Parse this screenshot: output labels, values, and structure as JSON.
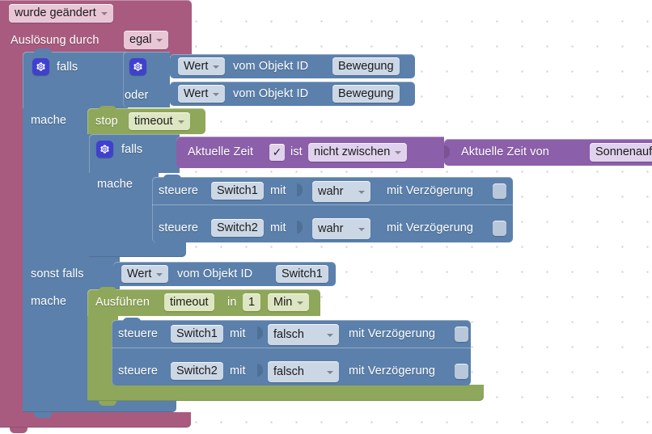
{
  "editor": {
    "name": "blockly-workspace",
    "background": "#ffffff",
    "grid_dot_color": "#cdcdd4",
    "colors": {
      "trigger_pink": "#a85b7f",
      "logic_blue": "#5b80ab",
      "timer_olive": "#8fa75a",
      "time_purple": "#8c5faa",
      "mutator_gear": "#4040d0"
    }
  },
  "trigger_block": {
    "name": "on-change-trigger",
    "event_dropdown": "wurde geändert",
    "source_label": "Auslösung durch",
    "source_dropdown": "egal"
  },
  "outer_if": {
    "if_label": "falls",
    "else_if_label": "sonst falls",
    "do_label": "mache",
    "condition_or_label": "oder",
    "condition_a": {
      "value_dropdown": "Wert",
      "middle_label": "vom Objekt ID",
      "object_id": "Bewegung"
    },
    "condition_b": {
      "value_dropdown": "Wert",
      "middle_label": "vom Objekt ID",
      "object_id": "Bewegung"
    },
    "elseif_condition": {
      "value_dropdown": "Wert",
      "middle_label": "vom Objekt ID",
      "object_id": "Switch1"
    }
  },
  "stop_timeout": {
    "name": "stop-timeout-block",
    "verb": "stop",
    "timer_dropdown": "timeout"
  },
  "inner_if": {
    "if_label": "falls",
    "do_label": "mache",
    "condition": {
      "prefix": "Aktuelle Zeit",
      "check_glyph": "✓",
      "is_label": "ist",
      "comparator_dropdown": "nicht zwischen",
      "operand_prefix": "Aktuelle Zeit von",
      "operand_dropdown": "Sonnenaufga"
    },
    "actions": [
      {
        "verb": "steuere",
        "object_id": "Switch1",
        "with_label": "mit",
        "value_dropdown": "wahr",
        "delay_label": "mit Verzögerung"
      },
      {
        "verb": "steuere",
        "object_id": "Switch2",
        "with_label": "mit",
        "value_dropdown": "wahr",
        "delay_label": "mit Verzögerung"
      }
    ]
  },
  "run_timeout": {
    "name": "run-timeout-block",
    "verb": "Ausführen",
    "timer_dropdown": "timeout",
    "in_label": "in",
    "amount": "1",
    "unit_dropdown": "Min",
    "actions": [
      {
        "verb": "steuere",
        "object_id": "Switch1",
        "with_label": "mit",
        "value_dropdown": "falsch",
        "delay_label": "mit Verzögerung"
      },
      {
        "verb": "steuere",
        "object_id": "Switch2",
        "with_label": "mit",
        "value_dropdown": "falsch",
        "delay_label": "mit Verzögerung"
      }
    ]
  }
}
